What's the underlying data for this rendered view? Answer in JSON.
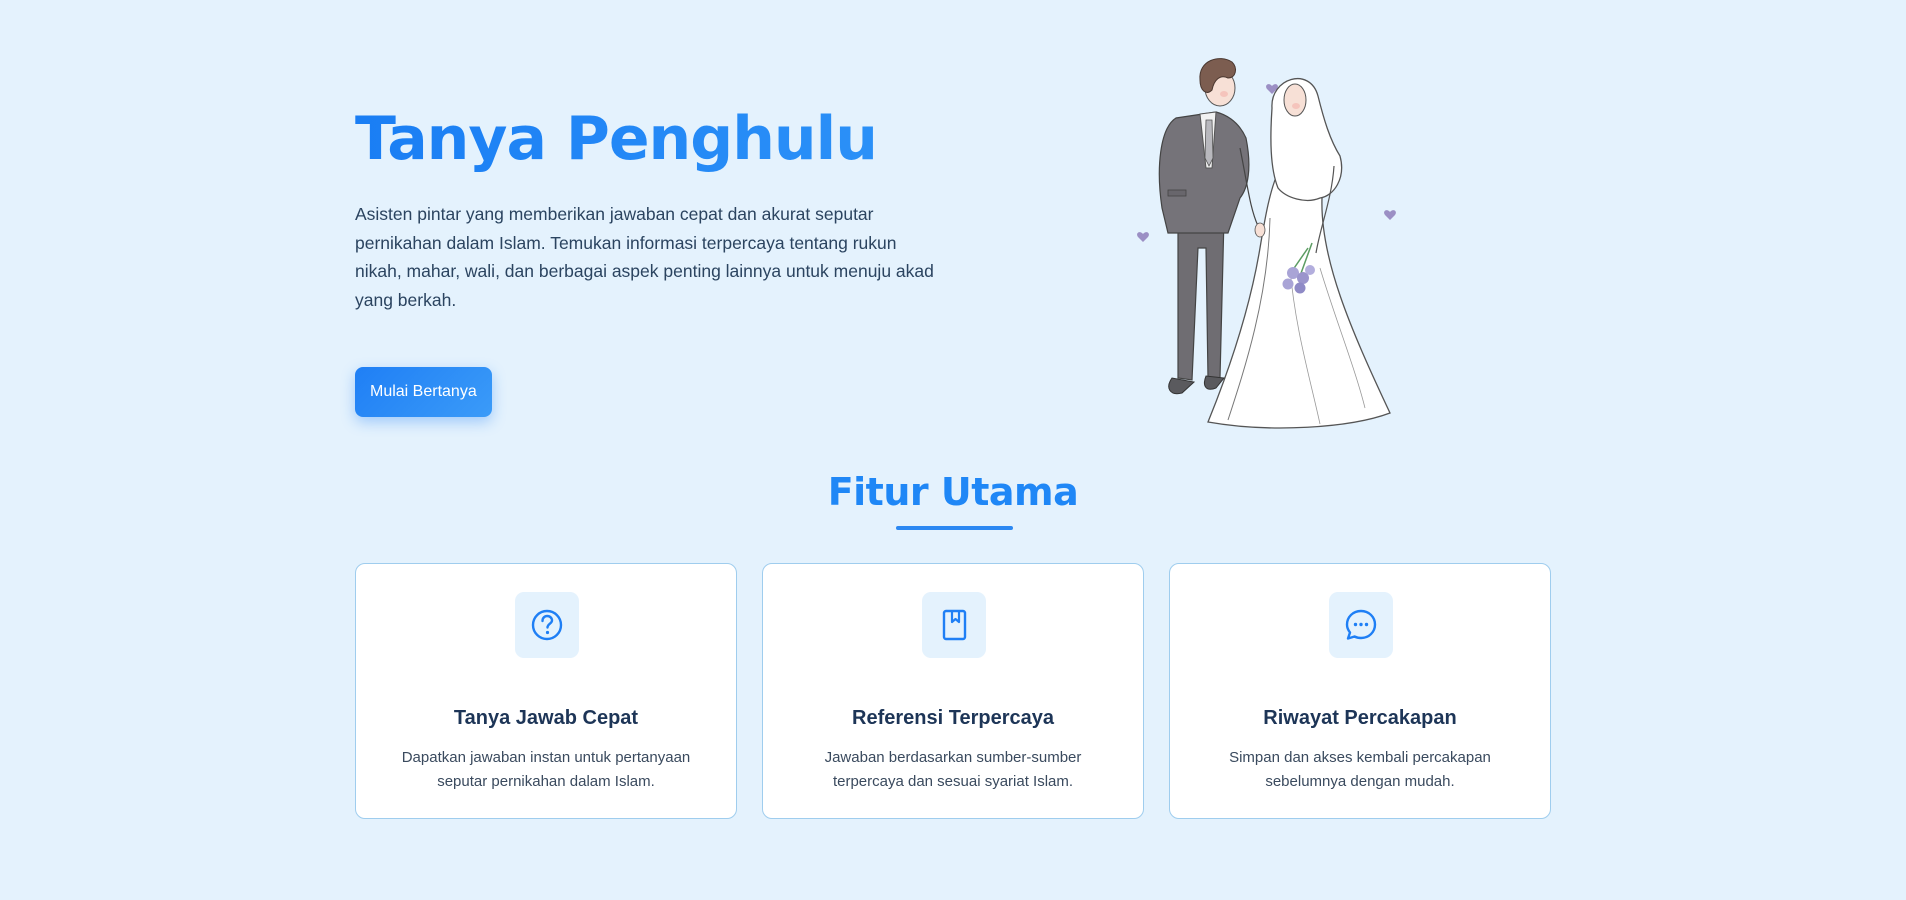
{
  "hero": {
    "title": "Tanya Penghulu",
    "description": "Asisten pintar yang memberikan jawaban cepat dan akurat seputar pernikahan dalam Islam. Temukan informasi terpercaya tentang rukun nikah, mahar, wali, dan berbagai aspek penting lainnya untuk menuju akad yang berkah.",
    "cta_label": "Mulai Bertanya",
    "illustration": "wedding-couple-illustration"
  },
  "features": {
    "title": "Fitur Utama",
    "items": [
      {
        "icon": "question-circle-icon",
        "title": "Tanya Jawab Cepat",
        "description": "Dapatkan jawaban instan untuk pertanyaan seputar pernikahan dalam Islam."
      },
      {
        "icon": "book-icon",
        "title": "Referensi Terpercaya",
        "description": "Jawaban berdasarkan sumber-sumber terpercaya dan sesuai syariat Islam."
      },
      {
        "icon": "chat-bubble-icon",
        "title": "Riwayat Percakapan",
        "description": "Simpan dan akses kembali percakapan sebelumnya dengan mudah."
      }
    ]
  },
  "colors": {
    "background": "#e4f2fd",
    "accent": "#1f87f6",
    "heading_dark": "#1d3557",
    "card_border": "#9fcdee"
  }
}
